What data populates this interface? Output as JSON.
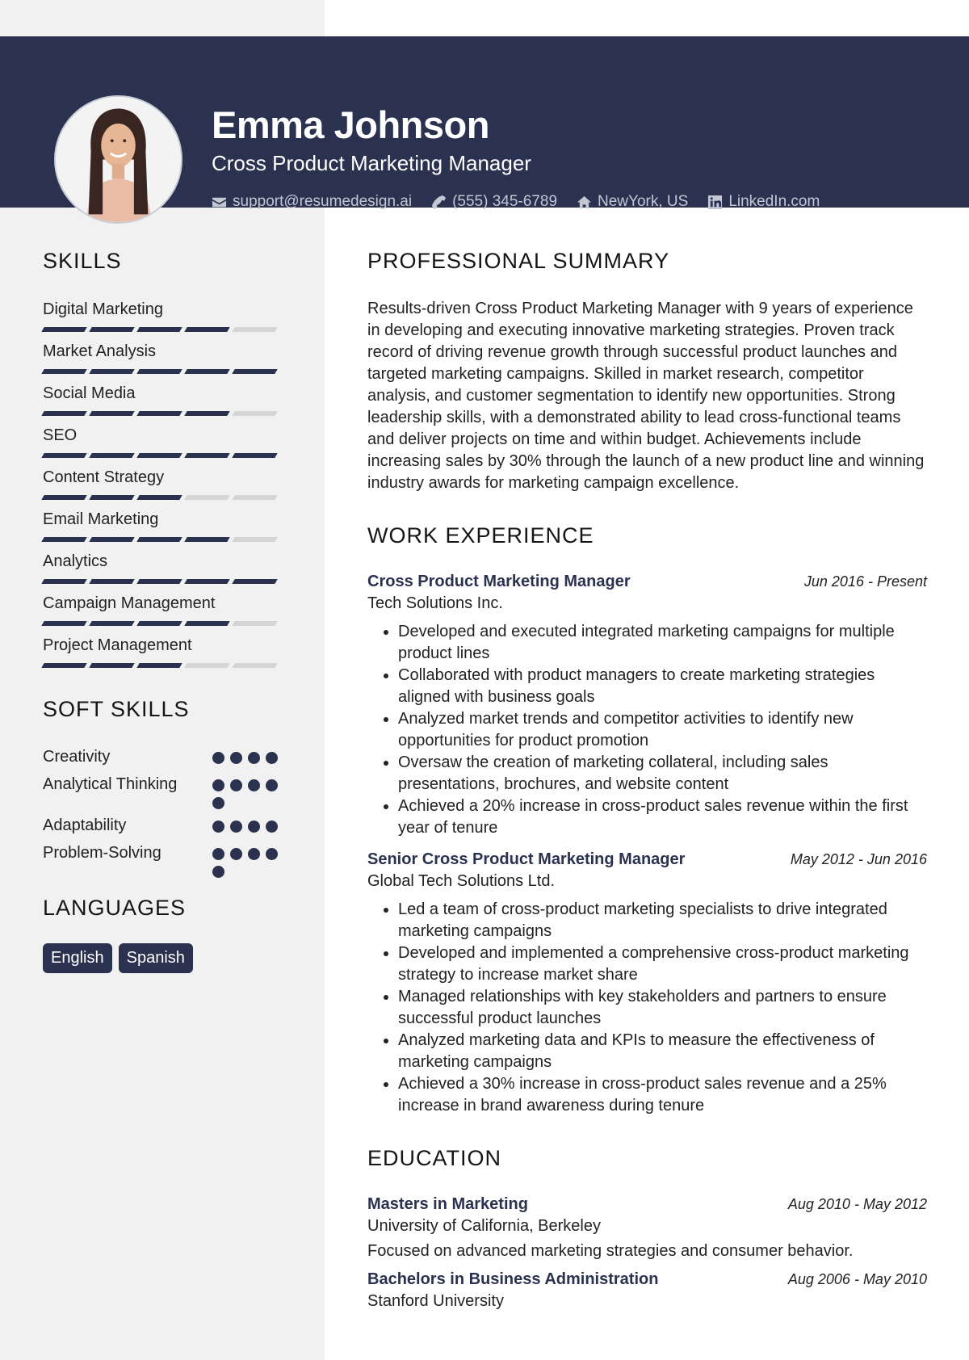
{
  "header": {
    "name": "Emma Johnson",
    "title": "Cross Product Marketing Manager",
    "contacts": [
      {
        "icon": "envelope-icon",
        "text": "support@resumedesign.ai"
      },
      {
        "icon": "phone-icon",
        "text": "(555) 345-6789"
      },
      {
        "icon": "home-icon",
        "text": "NewYork, US"
      },
      {
        "icon": "linkedin-icon",
        "text": "LinkedIn.com"
      }
    ]
  },
  "colors": {
    "accent": "#2a3250",
    "sidebar": "#f1f1f1",
    "bar_off": "#d5d5d5"
  },
  "skills": {
    "title": "SKILLS",
    "max": 5,
    "items": [
      {
        "name": "Digital Marketing",
        "level": 4
      },
      {
        "name": "Market Analysis",
        "level": 5
      },
      {
        "name": "Social Media",
        "level": 4
      },
      {
        "name": "SEO",
        "level": 5
      },
      {
        "name": "Content Strategy",
        "level": 3
      },
      {
        "name": "Email Marketing",
        "level": 4
      },
      {
        "name": "Analytics",
        "level": 5
      },
      {
        "name": "Campaign Management",
        "level": 4
      },
      {
        "name": "Project Management",
        "level": 3
      }
    ]
  },
  "soft_skills": {
    "title": "SOFT SKILLS",
    "items": [
      {
        "name": "Creativity",
        "level": 4
      },
      {
        "name": "Analytical Thinking",
        "level": 5
      },
      {
        "name": "Adaptability",
        "level": 4
      },
      {
        "name": "Problem-Solving",
        "level": 5
      }
    ]
  },
  "languages": {
    "title": "LANGUAGES",
    "items": [
      "English",
      "Spanish"
    ]
  },
  "summary": {
    "title": "PROFESSIONAL SUMMARY",
    "text": "Results-driven Cross Product Marketing Manager with 9 years of experience in developing and executing innovative marketing strategies. Proven track record of driving revenue growth through successful product launches and targeted marketing campaigns. Skilled in market research, competitor analysis, and customer segmentation to identify new opportunities. Strong leadership skills, with a demonstrated ability to lead cross-functional teams and deliver projects on time and within budget. Achievements include increasing sales by 30% through the launch of a new product line and winning industry awards for marketing campaign excellence."
  },
  "experience": {
    "title": "WORK EXPERIENCE",
    "jobs": [
      {
        "role": "Cross Product Marketing Manager",
        "dates": "Jun 2016 - Present",
        "company": "Tech Solutions Inc.",
        "bullets": [
          "Developed and executed integrated marketing campaigns for multiple product lines",
          "Collaborated with product managers to create marketing strategies aligned with business goals",
          "Analyzed market trends and competitor activities to identify new opportunities for product promotion",
          "Oversaw the creation of marketing collateral, including sales presentations, brochures, and website content",
          "Achieved a 20% increase in cross-product sales revenue within the first year of tenure"
        ]
      },
      {
        "role": "Senior Cross Product Marketing Manager",
        "dates": "May 2012 - Jun 2016",
        "company": "Global Tech Solutions Ltd.",
        "bullets": [
          "Led a team of cross-product marketing specialists to drive integrated marketing campaigns",
          "Developed and implemented a comprehensive cross-product marketing strategy to increase market share",
          "Managed relationships with key stakeholders and partners to ensure successful product launches",
          "Analyzed marketing data and KPIs to measure the effectiveness of marketing campaigns",
          "Achieved a 30% increase in cross-product sales revenue and a 25% increase in brand awareness during tenure"
        ]
      }
    ]
  },
  "education": {
    "title": "EDUCATION",
    "items": [
      {
        "degree": "Masters in Marketing",
        "dates": "Aug 2010 - May 2012",
        "school": "University of California, Berkeley",
        "desc": "Focused on advanced marketing strategies and consumer behavior."
      },
      {
        "degree": "Bachelors in Business Administration",
        "dates": "Aug 2006 - May 2010",
        "school": "Stanford University",
        "desc": ""
      }
    ]
  }
}
